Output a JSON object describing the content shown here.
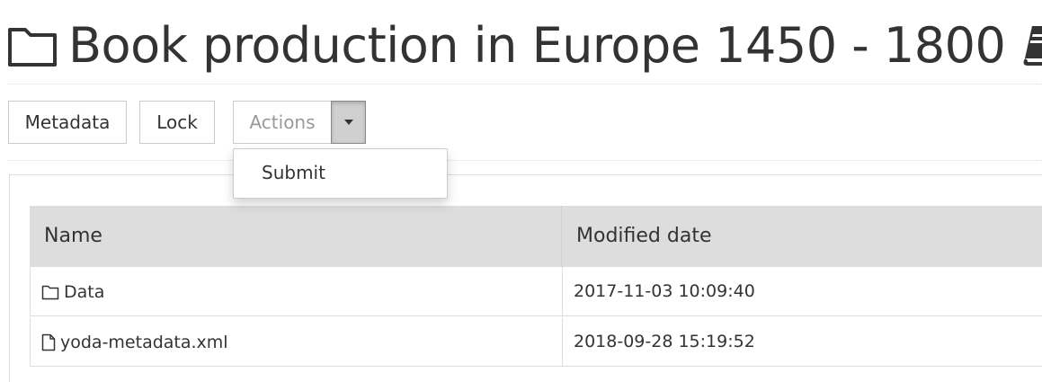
{
  "header": {
    "title": "Book production in Europe 1450 - 1800",
    "title_icon": "folder-outline-icon",
    "badge_icon": "book-icon"
  },
  "toolbar": {
    "metadata_label": "Metadata",
    "lock_label": "Lock",
    "actions_label": "Actions",
    "actions_toggle_icon": "caret-down-icon"
  },
  "actions_menu": {
    "items": [
      {
        "label": "Submit"
      }
    ]
  },
  "table": {
    "columns": [
      "Name",
      "Modified date"
    ],
    "rows": [
      {
        "icon": "folder-outline-icon",
        "name": "Data",
        "modified": "2017-11-03 10:09:40"
      },
      {
        "icon": "file-outline-icon",
        "name": "yoda-metadata.xml",
        "modified": "2018-09-28 15:19:52"
      }
    ]
  },
  "colors": {
    "text": "#333333",
    "muted_text": "#999999",
    "header_bg": "#dddddd",
    "border": "#cccccc",
    "active_toggle_bg": "#d0d0d0"
  }
}
